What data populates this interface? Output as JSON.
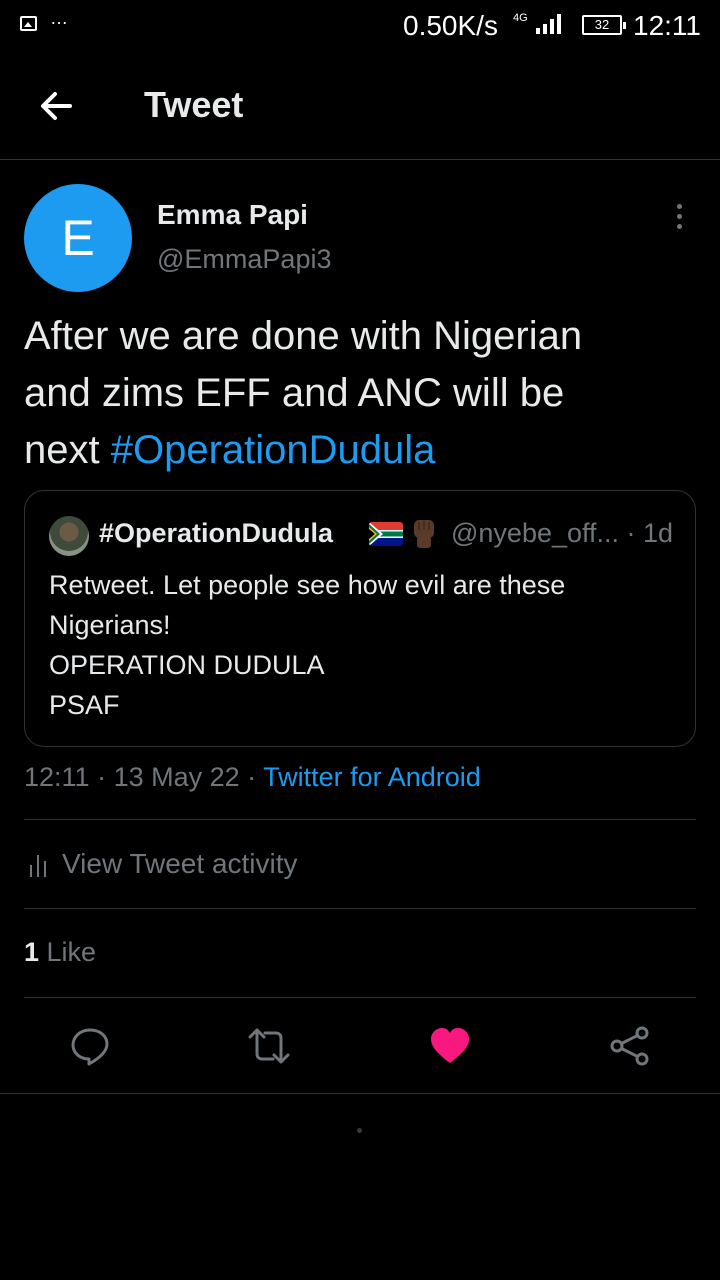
{
  "status_bar": {
    "dots": "…",
    "speed": "0.50K/s",
    "network": "4G",
    "battery": "32",
    "time": "12:11"
  },
  "header": {
    "title": "Tweet"
  },
  "author": {
    "avatar_letter": "E",
    "avatar_color": "#1d9bf0",
    "name": "Emma Papi",
    "handle": "@EmmaPapi3"
  },
  "tweet": {
    "text_line1": "After we are done with Nigerian",
    "text_line2": "and zims EFF and ANC will be",
    "text_line3_prefix": "next ",
    "hashtag": "#OperationDudula"
  },
  "quote": {
    "name": "#OperationDudula",
    "handle_time": "@nyebe_off... · 1d",
    "line1": "Retweet. Let people see how evil are these",
    "line2": "Nigerians!",
    "line3": "OPERATION DUDULA",
    "line4": "PSAF"
  },
  "meta": {
    "time": "12:11",
    "sep1": " · ",
    "date": "13 May 22",
    "sep2": " · ",
    "source": "Twitter for Android"
  },
  "activity": {
    "label": "View Tweet activity"
  },
  "likes": {
    "count": "1",
    "label": " Like"
  },
  "actions": {
    "icons": [
      "reply-icon",
      "retweet-icon",
      "like-icon",
      "share-icon"
    ],
    "like_color": "#f91880"
  },
  "colors": {
    "accent": "#1d9bf0",
    "secondary_text": "#71767b",
    "background": "#000000"
  }
}
